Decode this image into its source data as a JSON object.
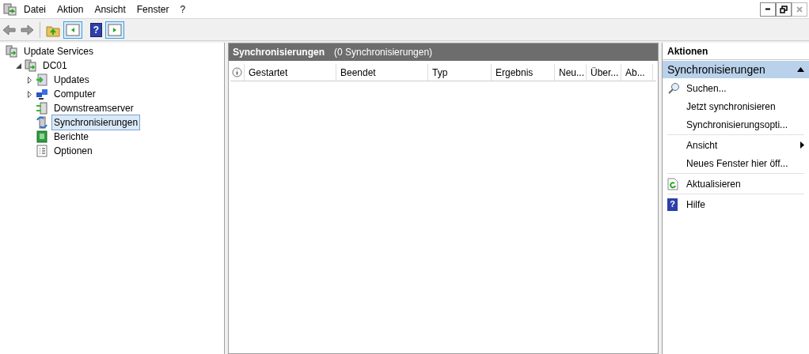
{
  "menu_bar": [
    "Datei",
    "Aktion",
    "Ansicht",
    "Fenster",
    "?"
  ],
  "toolbar": {
    "help_glyph": "?"
  },
  "tree": [
    {
      "label": "Update Services",
      "kind": "server",
      "selected": false,
      "children": [
        {
          "label": "DC01",
          "kind": "server",
          "expanded": true,
          "selected": false,
          "children": [
            {
              "label": "Updates",
              "kind": "updates",
              "expanded": false,
              "selected": false
            },
            {
              "label": "Computer",
              "kind": "computer",
              "expanded": false,
              "selected": false
            },
            {
              "label": "Downstreamserver",
              "kind": "downstream",
              "selected": false
            },
            {
              "label": "Synchronisierungen",
              "kind": "sync",
              "selected": true
            },
            {
              "label": "Berichte",
              "kind": "reports",
              "selected": false
            },
            {
              "label": "Optionen",
              "kind": "options",
              "selected": false
            }
          ]
        }
      ]
    }
  ],
  "center": {
    "title": "Synchronisierungen",
    "count": "(0 Synchronisierungen)",
    "columns": [
      "Gestartet",
      "Beendet",
      "Typ",
      "Ergebnis",
      "Neu...",
      "Über...",
      "Ab..."
    ]
  },
  "actions": {
    "heading": "Aktionen",
    "section": "Synchronisierungen",
    "groups": [
      [
        {
          "label": "Suchen...",
          "kind": "search"
        },
        {
          "label": "Jetzt synchronisieren",
          "kind": "plain"
        },
        {
          "label": "Synchronisierungsopti...",
          "kind": "plain"
        }
      ],
      [
        {
          "label": "Ansicht",
          "kind": "submenu"
        },
        {
          "label": "Neues Fenster hier öff...",
          "kind": "plain"
        }
      ],
      [
        {
          "label": "Aktualisieren",
          "kind": "refresh"
        }
      ],
      [
        {
          "label": "Hilfe",
          "kind": "help",
          "glyph": "?"
        }
      ]
    ]
  }
}
